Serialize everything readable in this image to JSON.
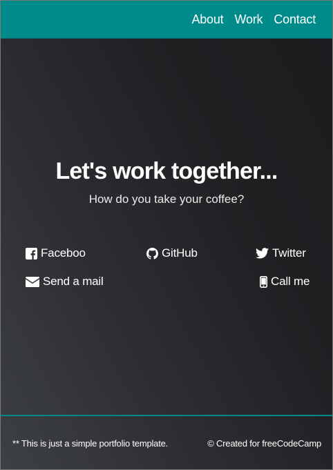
{
  "nav": {
    "items": [
      {
        "label": "About"
      },
      {
        "label": "Work"
      },
      {
        "label": "Contact"
      }
    ]
  },
  "hero": {
    "title": "Let's work together...",
    "subtitle": "How do you take your coffee?"
  },
  "contacts": {
    "facebook": {
      "label": "Faceboo",
      "icon": "facebook-icon"
    },
    "github": {
      "label": "GitHub",
      "icon": "github-icon"
    },
    "twitter": {
      "label": "Twitter",
      "icon": "twitter-icon"
    },
    "mail": {
      "label": "Send a mail",
      "icon": "envelope-icon"
    },
    "phone": {
      "label": "Call me",
      "icon": "mobile-phone-icon"
    }
  },
  "footer": {
    "left_text": "** This is just a simple portfolio template.",
    "right_text": "© Created for freeCodeCamp"
  },
  "colors": {
    "accent": "#008b8b",
    "background": "#2b2c30",
    "text": "#ffffff"
  }
}
